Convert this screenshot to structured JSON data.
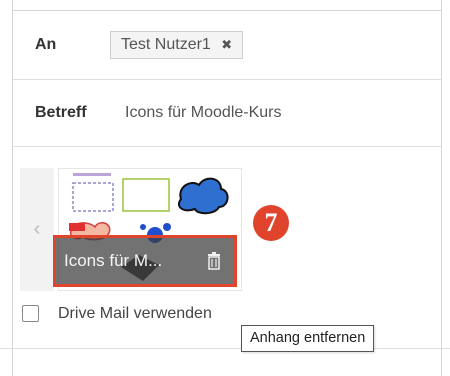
{
  "to": {
    "label": "An",
    "recipient": "Test Nutzer1",
    "remove_glyph": "✖"
  },
  "subject": {
    "label": "Betreff",
    "value": "Icons für Moodle-Kurs"
  },
  "attachment": {
    "prev_arrow": "‹",
    "name": "Icons für M...",
    "delete_icon": "trash-icon",
    "thumbnail_caption": "Icons für Moodle"
  },
  "callout": {
    "number": "7",
    "color": "#e0442d"
  },
  "drive_option": {
    "label": "Drive Mail verwenden",
    "checked": false
  },
  "tooltip": {
    "text": "Anhang entfernen"
  }
}
